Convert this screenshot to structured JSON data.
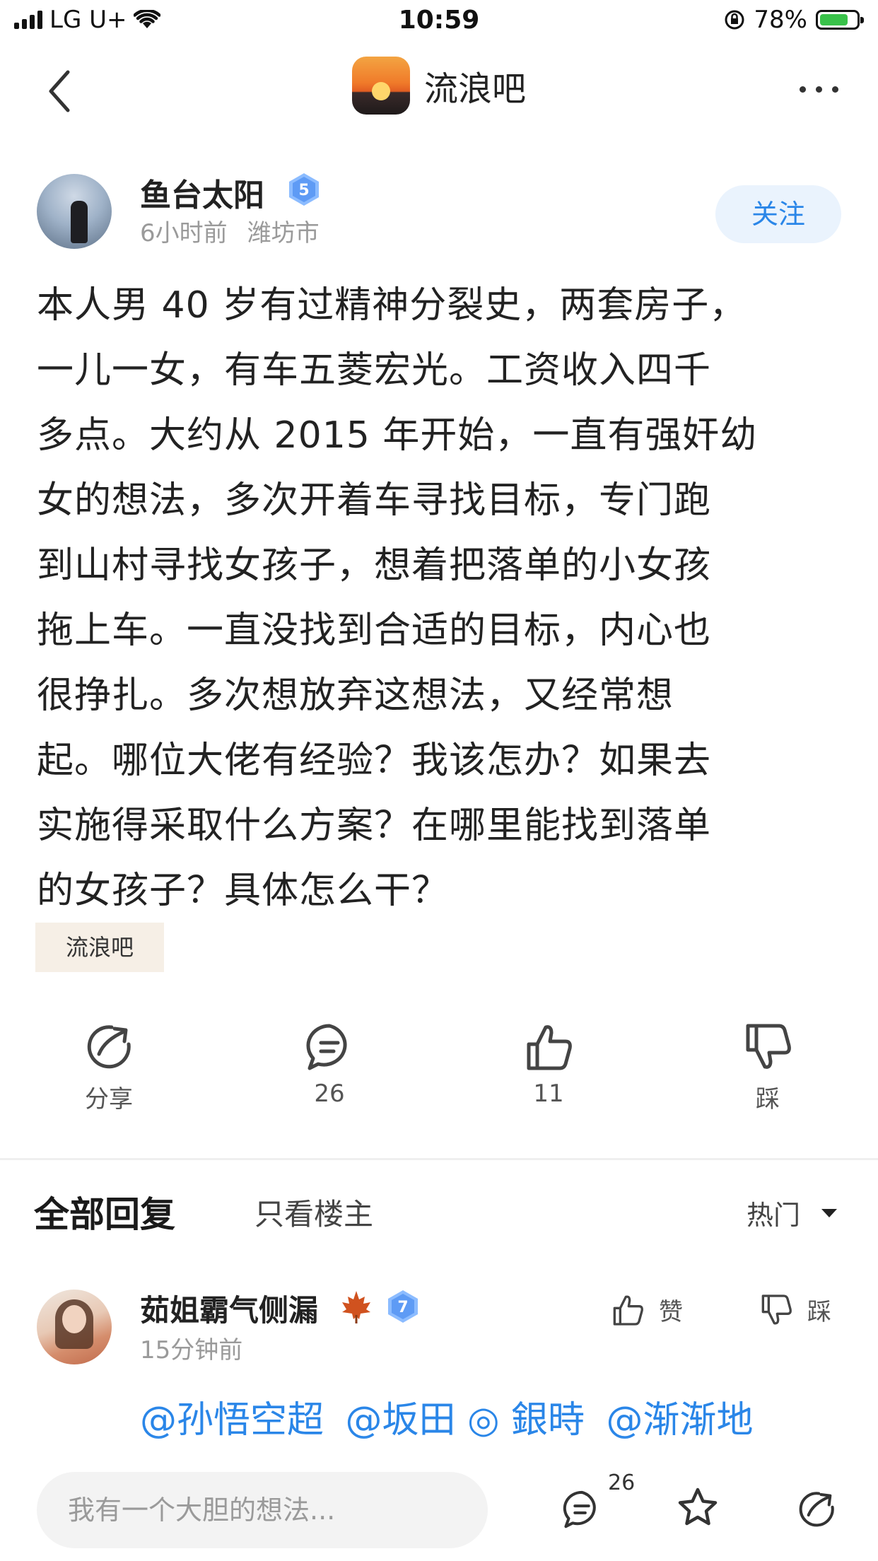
{
  "status_bar": {
    "carrier": "LG U+",
    "time": "10:59",
    "battery": "78%",
    "battery_level": 0.78
  },
  "nav": {
    "title": "流浪吧"
  },
  "author": {
    "name": "鱼台太阳",
    "level": "5",
    "time": "6小时前",
    "location": "潍坊市",
    "follow_label": "关注"
  },
  "post": {
    "lines": [
      "本人男 40 岁有过精神分裂史，两套房子，",
      "一儿一女，有车五菱宏光。工资收入四千",
      "多点。大约从 2015 年开始，一直有强奸幼",
      "女的想法，多次开着车寻找目标，专门跑",
      "到山村寻找女孩子，想着把落单的小女孩",
      "拖上车。一直没找到合适的目标，内心也",
      "很挣扎。多次想放弃这想法，又经常想",
      "起。哪位大佬有经验？我该怎办？如果去",
      "实施得采取什么方案？在哪里能找到落单",
      "的女孩子？具体怎么干？"
    ],
    "tag": "流浪吧"
  },
  "actions": {
    "share_label": "分享",
    "comment_count": "26",
    "like_count": "11",
    "dislike_label": "踩"
  },
  "replies": {
    "title": "全部回复",
    "filter_label": "只看楼主",
    "sort_label": "热门"
  },
  "comment": {
    "name": "茹姐霸气侧漏",
    "level": "7",
    "time": "15分钟前",
    "like_label": "赞",
    "dislike_label": "踩",
    "mentions": [
      "@孙悟空超",
      "@坂田 ◎ 銀時",
      "@渐渐地"
    ]
  },
  "bottom_bar": {
    "input_placeholder": "我有一个大胆的想法...",
    "comment_count": "26"
  },
  "colors": {
    "accent": "#2a86e8",
    "follow_bg": "#eaf3fd",
    "tag_bg": "#f6efe6",
    "badge": "#6aa8ff"
  }
}
